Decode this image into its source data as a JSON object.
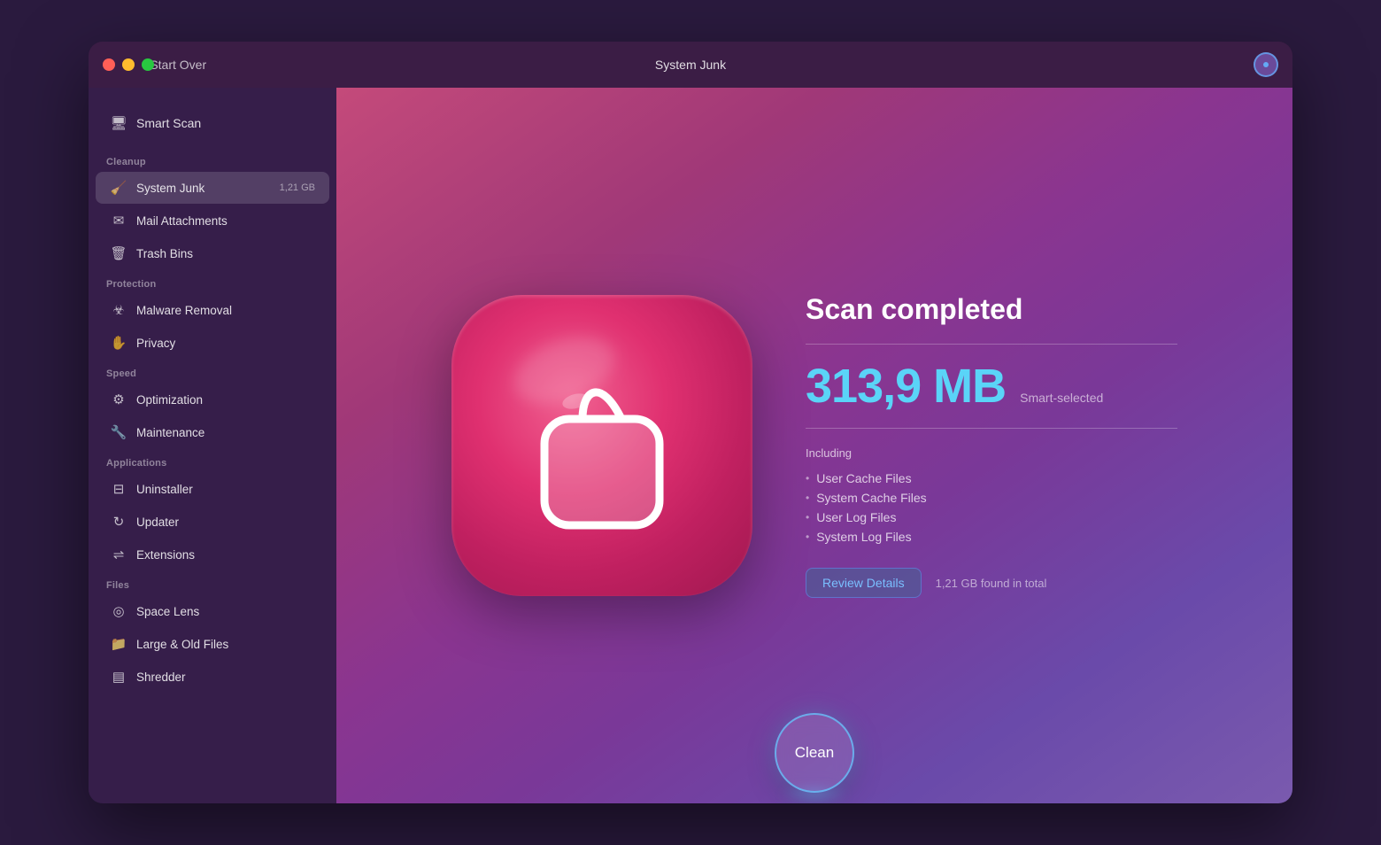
{
  "window": {
    "title": "System Junk"
  },
  "titlebar": {
    "back_label": "Start Over",
    "title": "System Junk",
    "traffic_lights": [
      "red",
      "yellow",
      "green"
    ]
  },
  "sidebar": {
    "smart_scan_label": "Smart Scan",
    "sections": [
      {
        "label": "Cleanup",
        "items": [
          {
            "id": "system-junk",
            "label": "System Junk",
            "badge": "1,21 GB",
            "active": true
          },
          {
            "id": "mail-attachments",
            "label": "Mail Attachments",
            "badge": "",
            "active": false
          },
          {
            "id": "trash-bins",
            "label": "Trash Bins",
            "badge": "",
            "active": false
          }
        ]
      },
      {
        "label": "Protection",
        "items": [
          {
            "id": "malware-removal",
            "label": "Malware Removal",
            "badge": "",
            "active": false
          },
          {
            "id": "privacy",
            "label": "Privacy",
            "badge": "",
            "active": false
          }
        ]
      },
      {
        "label": "Speed",
        "items": [
          {
            "id": "optimization",
            "label": "Optimization",
            "badge": "",
            "active": false
          },
          {
            "id": "maintenance",
            "label": "Maintenance",
            "badge": "",
            "active": false
          }
        ]
      },
      {
        "label": "Applications",
        "items": [
          {
            "id": "uninstaller",
            "label": "Uninstaller",
            "badge": "",
            "active": false
          },
          {
            "id": "updater",
            "label": "Updater",
            "badge": "",
            "active": false
          },
          {
            "id": "extensions",
            "label": "Extensions",
            "badge": "",
            "active": false
          }
        ]
      },
      {
        "label": "Files",
        "items": [
          {
            "id": "space-lens",
            "label": "Space Lens",
            "badge": "",
            "active": false
          },
          {
            "id": "large-old-files",
            "label": "Large & Old Files",
            "badge": "",
            "active": false
          },
          {
            "id": "shredder",
            "label": "Shredder",
            "badge": "",
            "active": false
          }
        ]
      }
    ]
  },
  "main": {
    "scan_completed": "Scan completed",
    "size": "313,9 MB",
    "smart_selected": "Smart-selected",
    "including_label": "Including",
    "including_items": [
      "User Cache Files",
      "System Cache Files",
      "User Log Files",
      "System Log Files"
    ],
    "review_btn": "Review Details",
    "total_label": "1,21 GB found in total",
    "clean_btn": "Clean"
  },
  "icons": {
    "smart_scan": "🖥",
    "system_junk": "🗑",
    "mail": "✉",
    "trash": "🗑",
    "malware": "☣",
    "privacy": "✋",
    "optimization": "⚙",
    "maintenance": "🔧",
    "uninstaller": "⊟",
    "updater": "↻",
    "extensions": "⇌",
    "space_lens": "◎",
    "large_files": "📁",
    "shredder": "▤",
    "back": "‹"
  }
}
